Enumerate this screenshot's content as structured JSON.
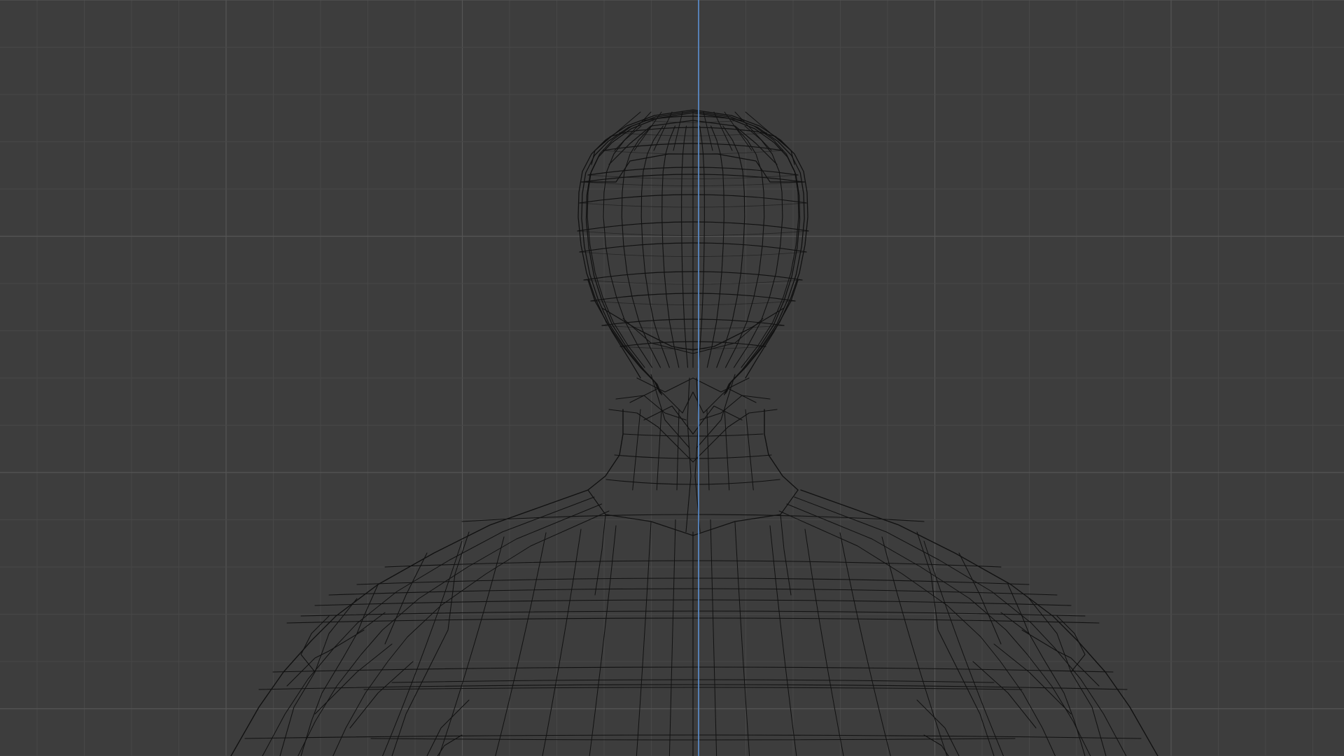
{
  "viewport": {
    "view": "front-orthographic-wireframe",
    "background_color": "#3d3d3d",
    "grid_minor_color": "#474747",
    "grid_major_color": "#555555",
    "z_axis_color": "#5b8fd1",
    "wire_color": "#111111",
    "shows_grid": true,
    "shows_z_axis": true,
    "object": "character-head-and-torso-mesh"
  }
}
